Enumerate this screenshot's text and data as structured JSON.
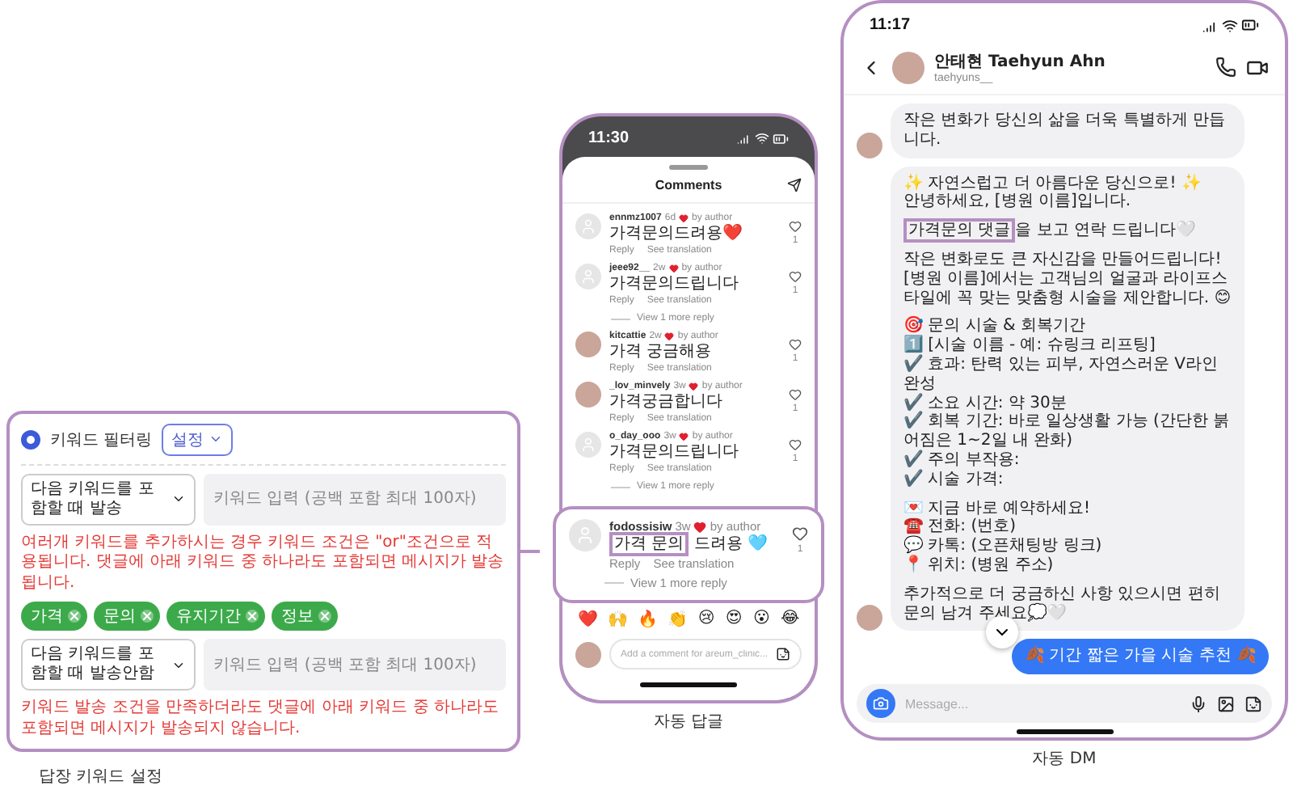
{
  "keyword_panel": {
    "title": "키워드 필터링",
    "mode": "설정",
    "rules": [
      {
        "condition": "다음 키워드를 포함할 때 발송",
        "placeholder": "키워드 입력 (공백 포함 최대 100자)",
        "note": "여러개 키워드를 추가하시는 경우 키워드 조건은 \"or\"조건으로 적용됩니다. 댓글에 아래 키워드 중 하나라도 포함되면 메시지가 발송됩니다.",
        "keywords": [
          "가격",
          "문의",
          "유지기간",
          "정보"
        ]
      },
      {
        "condition": "다음 키워드를 포함할 때 발송안함",
        "placeholder": "키워드 입력 (공백 포함 최대 100자)",
        "note": "키워드 발송 조건을 만족하더라도 댓글에 아래 키워드 중 하나라도 포함되면 메시지가 발송되지 않습니다."
      }
    ],
    "caption": "답장 키워드 설정"
  },
  "comments_phone": {
    "time": "11:30",
    "title": "Comments",
    "comments": [
      {
        "user": "ennmz1007",
        "age": "6d",
        "photo_avatar": false,
        "liked_by_author": true,
        "author_label": "by author",
        "text": "가격문의드려용❤️",
        "reply": "Reply",
        "translate": "See translation",
        "likes": "1"
      },
      {
        "user": "jeee92__",
        "age": "2w",
        "photo_avatar": false,
        "liked_by_author": true,
        "author_label": "by author",
        "text": "가격문의드립니다",
        "reply": "Reply",
        "translate": "See translation",
        "likes": "1",
        "more_replies": "View 1 more reply"
      },
      {
        "user": "kitcattie",
        "age": "2w",
        "photo_avatar": true,
        "liked_by_author": true,
        "author_label": "by author",
        "text": "가격 궁금해용",
        "reply": "Reply",
        "translate": "See translation",
        "likes": "1"
      },
      {
        "user": "_lov_minvely",
        "age": "3w",
        "photo_avatar": true,
        "liked_by_author": true,
        "author_label": "by author",
        "text": "가격궁금합니다",
        "reply": "Reply",
        "translate": "See translation",
        "likes": "1"
      },
      {
        "user": "o_day_ooo",
        "age": "3w",
        "photo_avatar": false,
        "liked_by_author": true,
        "author_label": "by author",
        "text": "가격문의드립니다",
        "reply": "Reply",
        "translate": "See translation",
        "likes": "1",
        "more_replies": "View 1 more reply"
      }
    ],
    "featured": {
      "user": "fodossisiw",
      "age": "3w",
      "photo_avatar": false,
      "liked_by_author": true,
      "author_label": "by author",
      "highlight": "가격 문의",
      "text": "드려용 🩵",
      "reply": "Reply",
      "translate": "See translation",
      "likes": "1",
      "more_replies": "View 1 more reply"
    },
    "reactions": [
      "❤️",
      "🙌",
      "🔥",
      "👏",
      "😢",
      "😍",
      "😮",
      "😂"
    ],
    "comment_placeholder": "Add a comment for areum_clinic...",
    "caption": "자동 답글"
  },
  "dm_phone": {
    "time": "11:17",
    "name": "안태현 Taehyun Ahn",
    "handle": "taehyuns__",
    "messages": [
      {
        "kind": "received",
        "paragraphs": [
          [
            "작은 변화가 당신의 삶을 더욱 특별하게 만듭니다."
          ]
        ]
      },
      {
        "kind": "received",
        "paragraphs": [
          [
            "✨ 자연스럽고 더 아름다운 당신으로! ✨",
            "안녕하세요, [병원 이름]입니다."
          ],
          [
            {
              "highlight": "가격문의 댓글",
              "text": "을 보고 연락 드립니다🤍"
            }
          ],
          [
            "작은 변화로도 큰 자신감을 만들어드립니다!",
            "[병원 이름]에서는 고객님의 얼굴과 라이프스타일에 꼭 맞는 맞춤형 시술을 제안합니다. 😊"
          ],
          [
            "🎯 문의 시술 & 회복기간",
            "1️⃣ [시술 이름 - 예: 슈링크 리프팅]",
            "✔️ 효과: 탄력 있는 피부, 자연스러운 V라인 완성",
            "✔️ 소요 시간: 약 30분",
            "✔️ 회복 기간: 바로 일상생활 가능 (간단한 붉어짐은 1~2일 내 완화)",
            "✔️ 주의 부작용:",
            "✔️ 시술 가격:"
          ],
          [
            "💌 지금 바로 예약하세요!",
            "☎️ 전화: (번호)",
            "💬 카톡: (오픈채팅방 링크)",
            "📍 위치: (병원 주소)"
          ],
          [
            "추가적으로 더 궁금하신 사항 있으시면 편히 문의 남겨 주세요💭🤍"
          ]
        ]
      },
      {
        "kind": "sent",
        "paragraphs": [
          [
            "🍂 기간 짧은 가을 시술 추천 🍂"
          ]
        ]
      }
    ],
    "message_placeholder": "Message...",
    "caption": "자동 DM"
  }
}
